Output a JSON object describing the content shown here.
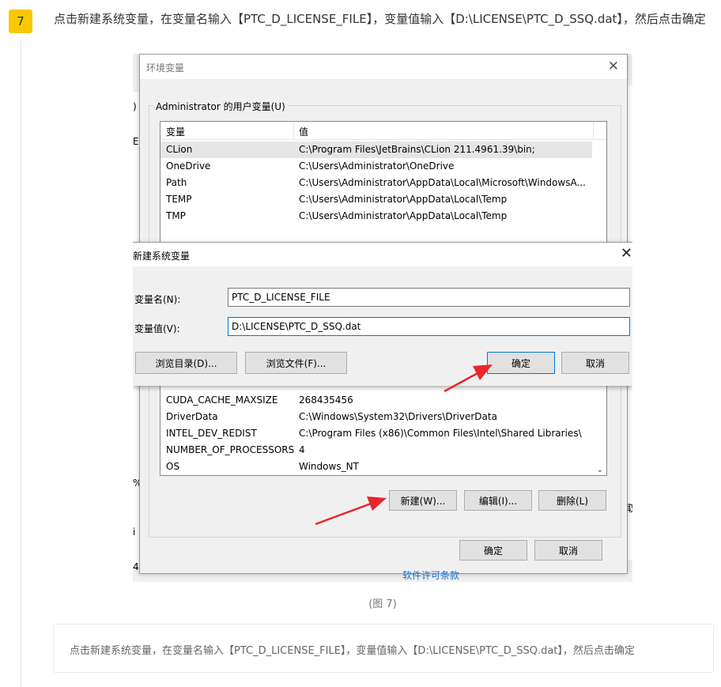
{
  "step": {
    "number": "7",
    "instruction": "点击新建系统变量，在变量名输入【PTC_D_LICENSE_FILE】，变量值输入【D:\\LICENSE\\PTC_D_SSQ.dat】，然后点击确定"
  },
  "background_fragments": {
    "frag1": ")",
    "frag2": "E",
    "frag3": "%",
    "frag4": "4",
    "frag5": "取",
    "frag6": "i"
  },
  "env_dialog": {
    "title": "环境变量",
    "close_glyph": "✕",
    "user_group_label": "Administrator 的用户变量(U)",
    "columns": [
      "变量",
      "值"
    ],
    "user_vars": [
      {
        "name": "CLion",
        "value": "C:\\Program Files\\JetBrains\\CLion 211.4961.39\\bin;"
      },
      {
        "name": "OneDrive",
        "value": "C:\\Users\\Administrator\\OneDrive"
      },
      {
        "name": "Path",
        "value": "C:\\Users\\Administrator\\AppData\\Local\\Microsoft\\WindowsA..."
      },
      {
        "name": "TEMP",
        "value": "C:\\Users\\Administrator\\AppData\\Local\\Temp"
      },
      {
        "name": "TMP",
        "value": "C:\\Users\\Administrator\\AppData\\Local\\Temp"
      }
    ],
    "system_vars": [
      {
        "name": "CUDA_CACHE_MAXSIZE",
        "value": "268435456"
      },
      {
        "name": "DriverData",
        "value": "C:\\Windows\\System32\\Drivers\\DriverData"
      },
      {
        "name": "INTEL_DEV_REDIST",
        "value": "C:\\Program Files (x86)\\Common Files\\Intel\\Shared Libraries\\"
      },
      {
        "name": "NUMBER_OF_PROCESSORS",
        "value": "4"
      },
      {
        "name": "OS",
        "value": "Windows_NT"
      }
    ],
    "btn_new": "新建(W)...",
    "btn_edit": "编辑(I)...",
    "btn_delete": "删除(L)",
    "btn_ok": "确定",
    "btn_cancel": "取消",
    "scroll_glyph": "⌄"
  },
  "new_var_dialog": {
    "title": "新建系统变量",
    "close_glyph": "✕",
    "name_label": "变量名(N):",
    "name_value": "PTC_D_LICENSE_FILE",
    "value_label": "变量值(V):",
    "value_value": "D:\\LICENSE\\PTC_D_SSQ.dat",
    "btn_browse_dir": "浏览目录(D)...",
    "btn_browse_file": "浏览文件(F)...",
    "btn_ok": "确定",
    "btn_cancel": "取消"
  },
  "below_link": "软件许可条款",
  "caption": "(图 7)",
  "tip": "点击新建系统变量，在变量名输入【PTC_D_LICENSE_FILE】，变量值输入【D:\\LICENSE\\PTC_D_SSQ.dat】，然后点击确定",
  "colors": {
    "badge": "#f8c800",
    "arrow": "#e8262b",
    "focus": "#0078d7"
  }
}
